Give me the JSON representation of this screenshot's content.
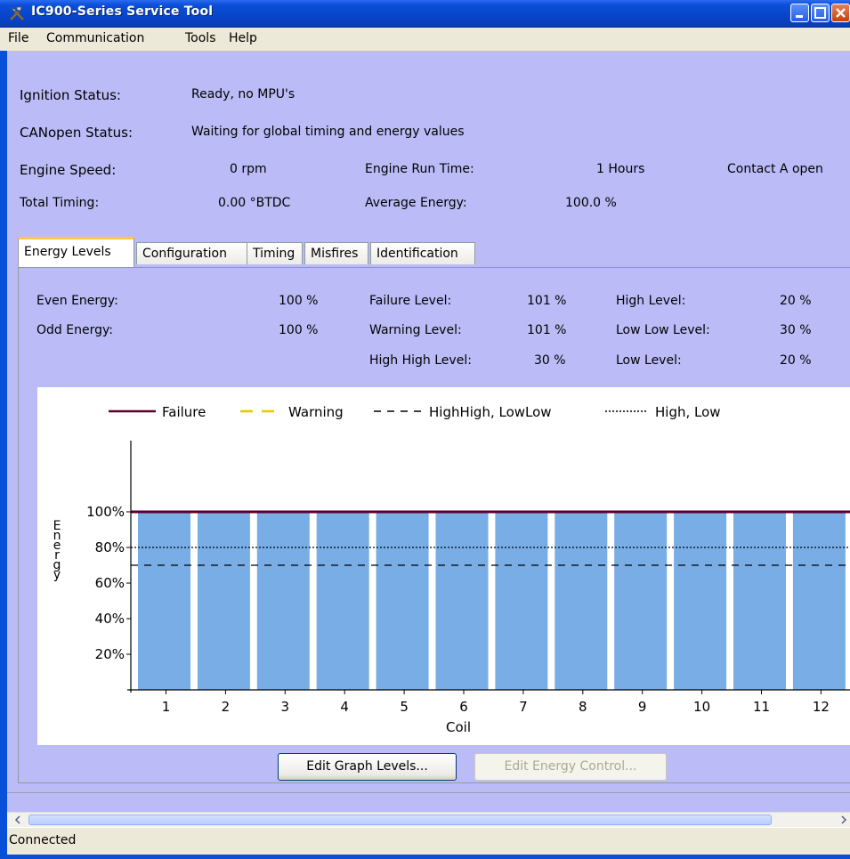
{
  "window": {
    "title": "IC900-Series Service Tool"
  },
  "menu": {
    "file": "File",
    "communication": "Communication",
    "tools": "Tools",
    "help": "Help"
  },
  "status": {
    "ignition_label": "Ignition Status:",
    "ignition_value": "Ready, no MPU's",
    "canopen_label": "CANopen Status:",
    "canopen_value": "Waiting for global timing and energy values",
    "speed_label": "Engine Speed:",
    "speed_value": "0 rpm",
    "runtime_label": "Engine Run Time:",
    "runtime_value": "1 Hours",
    "contact_value": "Contact A open",
    "timing_label": "Total Timing:",
    "timing_value": "0.00 °BTDC",
    "avg_energy_label": "Average Energy:",
    "avg_energy_value": "100.0 %"
  },
  "tabs": [
    "Energy Levels",
    "Configuration",
    "Timing",
    "Misfires",
    "Identification"
  ],
  "levels": {
    "even_label": "Even Energy:",
    "even_value": "100 %",
    "odd_label": "Odd Energy:",
    "odd_value": "100 %",
    "failure_label": "Failure Level:",
    "failure_value": "101 %",
    "warning_label": "Warning Level:",
    "warning_value": "101 %",
    "highhigh_label": "High High Level:",
    "highhigh_value": "30 %",
    "high_label": "High Level:",
    "high_value": "20 %",
    "lowlow_label": "Low Low Level:",
    "lowlow_value": "30 %",
    "low_label": "Low Level:",
    "low_value": "20 %"
  },
  "buttons": {
    "edit_graph": "Edit Graph Levels...",
    "edit_energy": "Edit Energy Control..."
  },
  "statusbar": {
    "text": "Connected"
  },
  "chart_data": {
    "type": "bar",
    "xlabel": "Coil",
    "ylabel": "Energy",
    "categories": [
      "1",
      "2",
      "3",
      "4",
      "5",
      "6",
      "7",
      "8",
      "9",
      "10",
      "11",
      "12"
    ],
    "values": [
      100,
      100,
      100,
      100,
      100,
      100,
      100,
      100,
      100,
      100,
      100,
      100
    ],
    "y_ticks": [
      "20%",
      "40%",
      "60%",
      "80%",
      "100%"
    ],
    "ylim": [
      0,
      140
    ],
    "legend": [
      "Failure",
      "Warning",
      "HighHigh, LowLow",
      "High, Low"
    ],
    "reference_lines": {
      "failure": 100,
      "high": 80,
      "highhigh": 70
    },
    "colors": {
      "bar": "#79ade6",
      "failure": "#5a0030",
      "warning": "#e8c800",
      "lines": "#000000"
    }
  }
}
